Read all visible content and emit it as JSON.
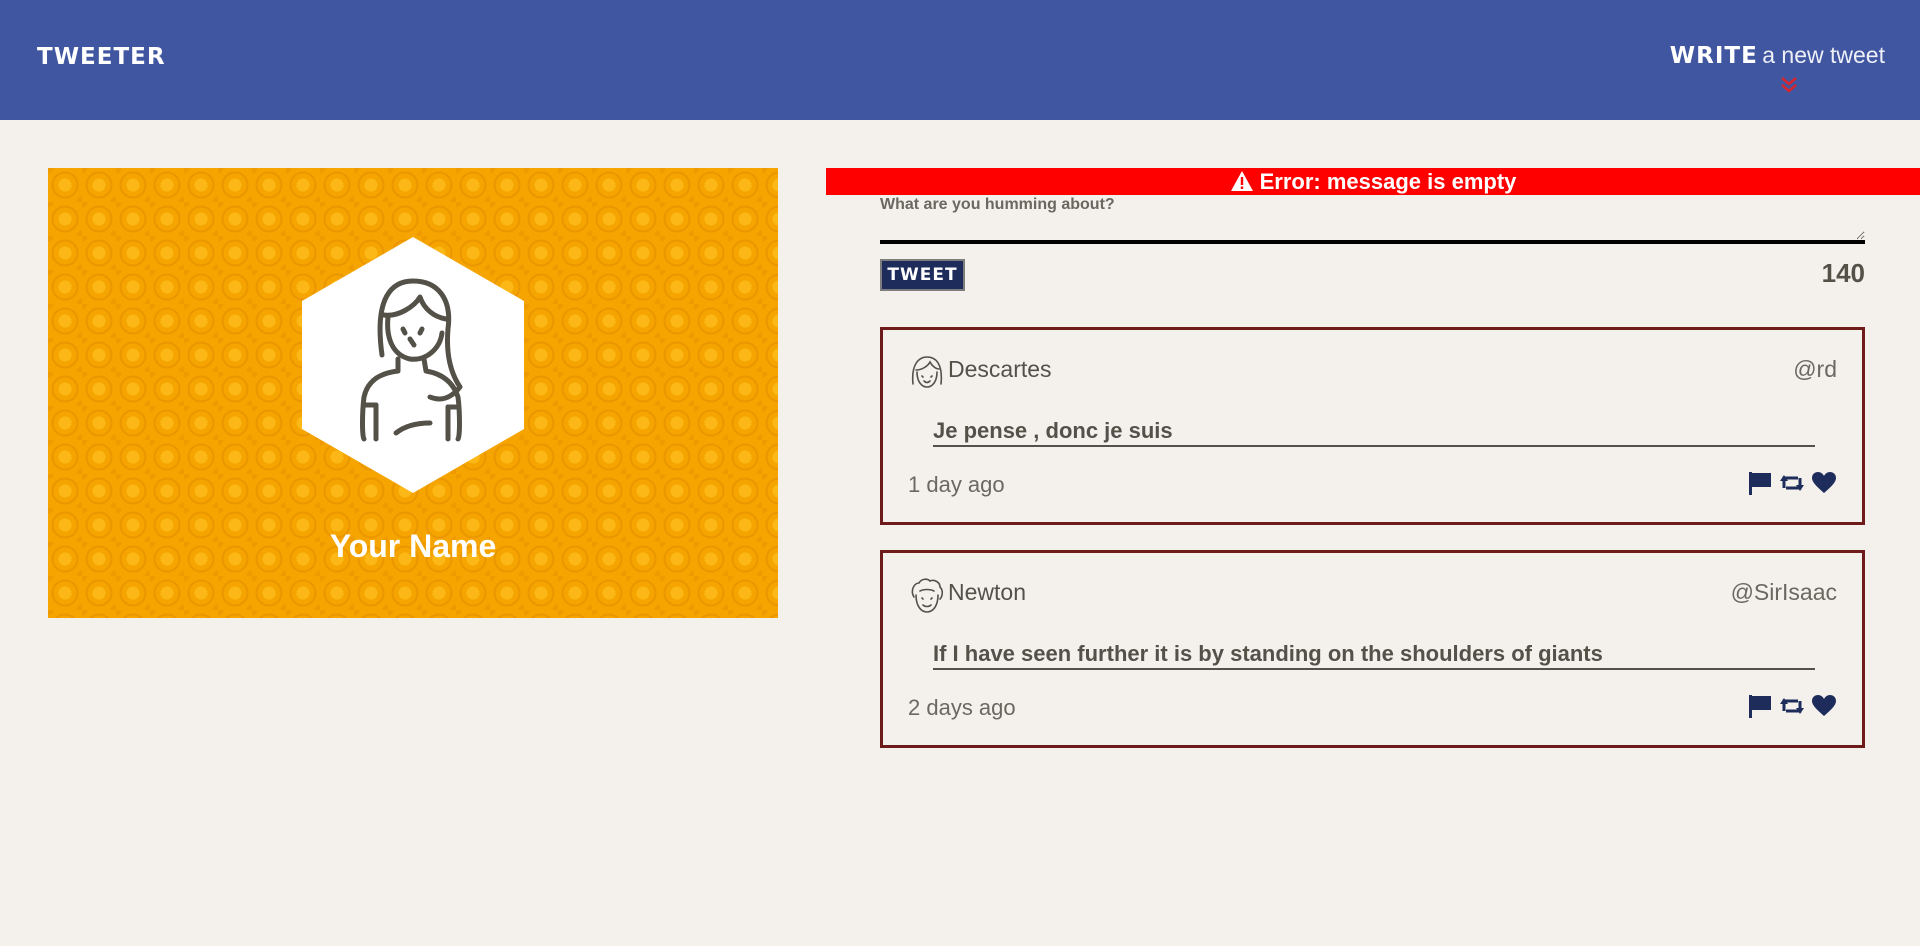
{
  "nav": {
    "brand": "TWEETER",
    "compose_strong": "WRITE",
    "compose_light": "a new tweet",
    "accent_color": "#4056a1",
    "chevron_color": "#d7262d"
  },
  "profile": {
    "name": "Your Name",
    "avatar_icon": "woman-avatar-icon",
    "background_color": "#f6a500"
  },
  "error": {
    "icon": "warning-icon",
    "message": "Error: message is empty",
    "color": "#ff0000"
  },
  "compose": {
    "placeholder": "What are you humming about?",
    "value": "",
    "button_label": "TWEET",
    "counter": "140"
  },
  "tweets": [
    {
      "author": "Descartes",
      "handle": "@rd",
      "avatar_icon": "girl-avatar-icon",
      "content": "Je pense , donc je suis",
      "time": "1 day ago",
      "actions": [
        "flag-icon",
        "retweet-icon",
        "heart-icon"
      ]
    },
    {
      "author": "Newton",
      "handle": "@SirIsaac",
      "avatar_icon": "curly-hair-avatar-icon",
      "content": "If I have seen further it is by standing on the shoulders of giants",
      "time": "2 days ago",
      "actions": [
        "flag-icon",
        "retweet-icon",
        "heart-icon"
      ]
    }
  ]
}
